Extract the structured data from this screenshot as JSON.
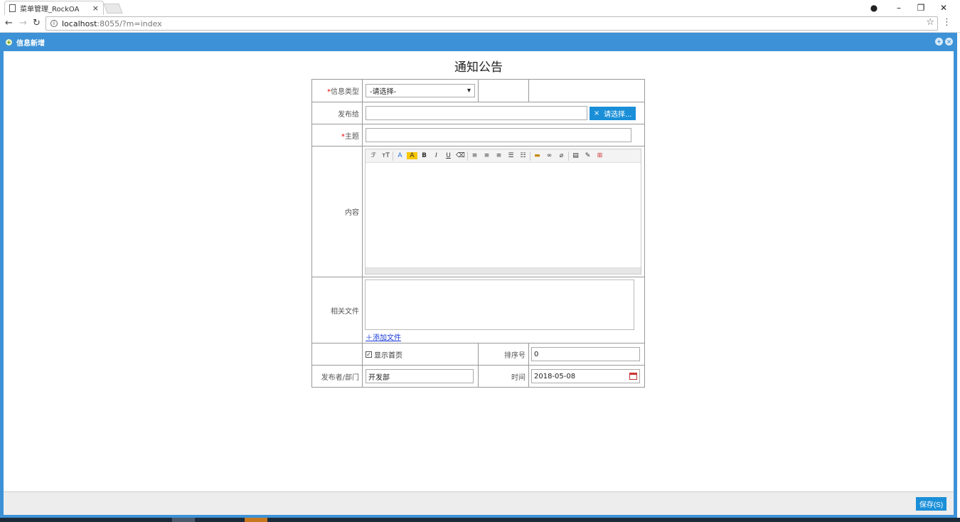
{
  "browser": {
    "tab_title": "菜单管理_RockOA",
    "tab_close": "×",
    "url_host": "localhost",
    "url_path": ":8055/?m=index",
    "window_controls": [
      "minimize-icon",
      "restore-icon",
      "close-icon"
    ]
  },
  "dialog": {
    "title": "信息新增",
    "form_title": "通知公告",
    "save_label": "保存(S)"
  },
  "form": {
    "type_label": "信息类型",
    "type_value": "-请选择-",
    "publish_to_label": "发布给",
    "publish_to_value": "",
    "pick_button_x": "×",
    "pick_button_label": "请选择...",
    "subject_label": "主题",
    "subject_value": "",
    "content_label": "内容",
    "files_label": "相关文件",
    "add_file_label": "＋添加文件",
    "show_home_label": "显示首页",
    "show_home_checked": true,
    "sort_label": "排序号",
    "sort_value": "0",
    "publisher_label": "发布者/部门",
    "publisher_value": "开发部",
    "time_label": "时间",
    "time_value": "2018-05-08",
    "required_mark": "*"
  },
  "editor_toolbar": [
    "font-family-icon",
    "font-size-icon",
    "font-color-icon",
    "bg-color-icon",
    "bold-icon",
    "italic-icon",
    "underline-icon",
    "eraser-icon",
    "align-left-icon",
    "align-center-icon",
    "align-right-icon",
    "ordered-list-icon",
    "unordered-list-icon",
    "image-icon",
    "link-icon",
    "unlink-icon",
    "source-icon",
    "clear-icon",
    "fullscreen-icon"
  ],
  "colors": {
    "dialog_blue": "#3d92d7",
    "button_blue": "#1a8fd8",
    "required_red": "#e00000"
  }
}
